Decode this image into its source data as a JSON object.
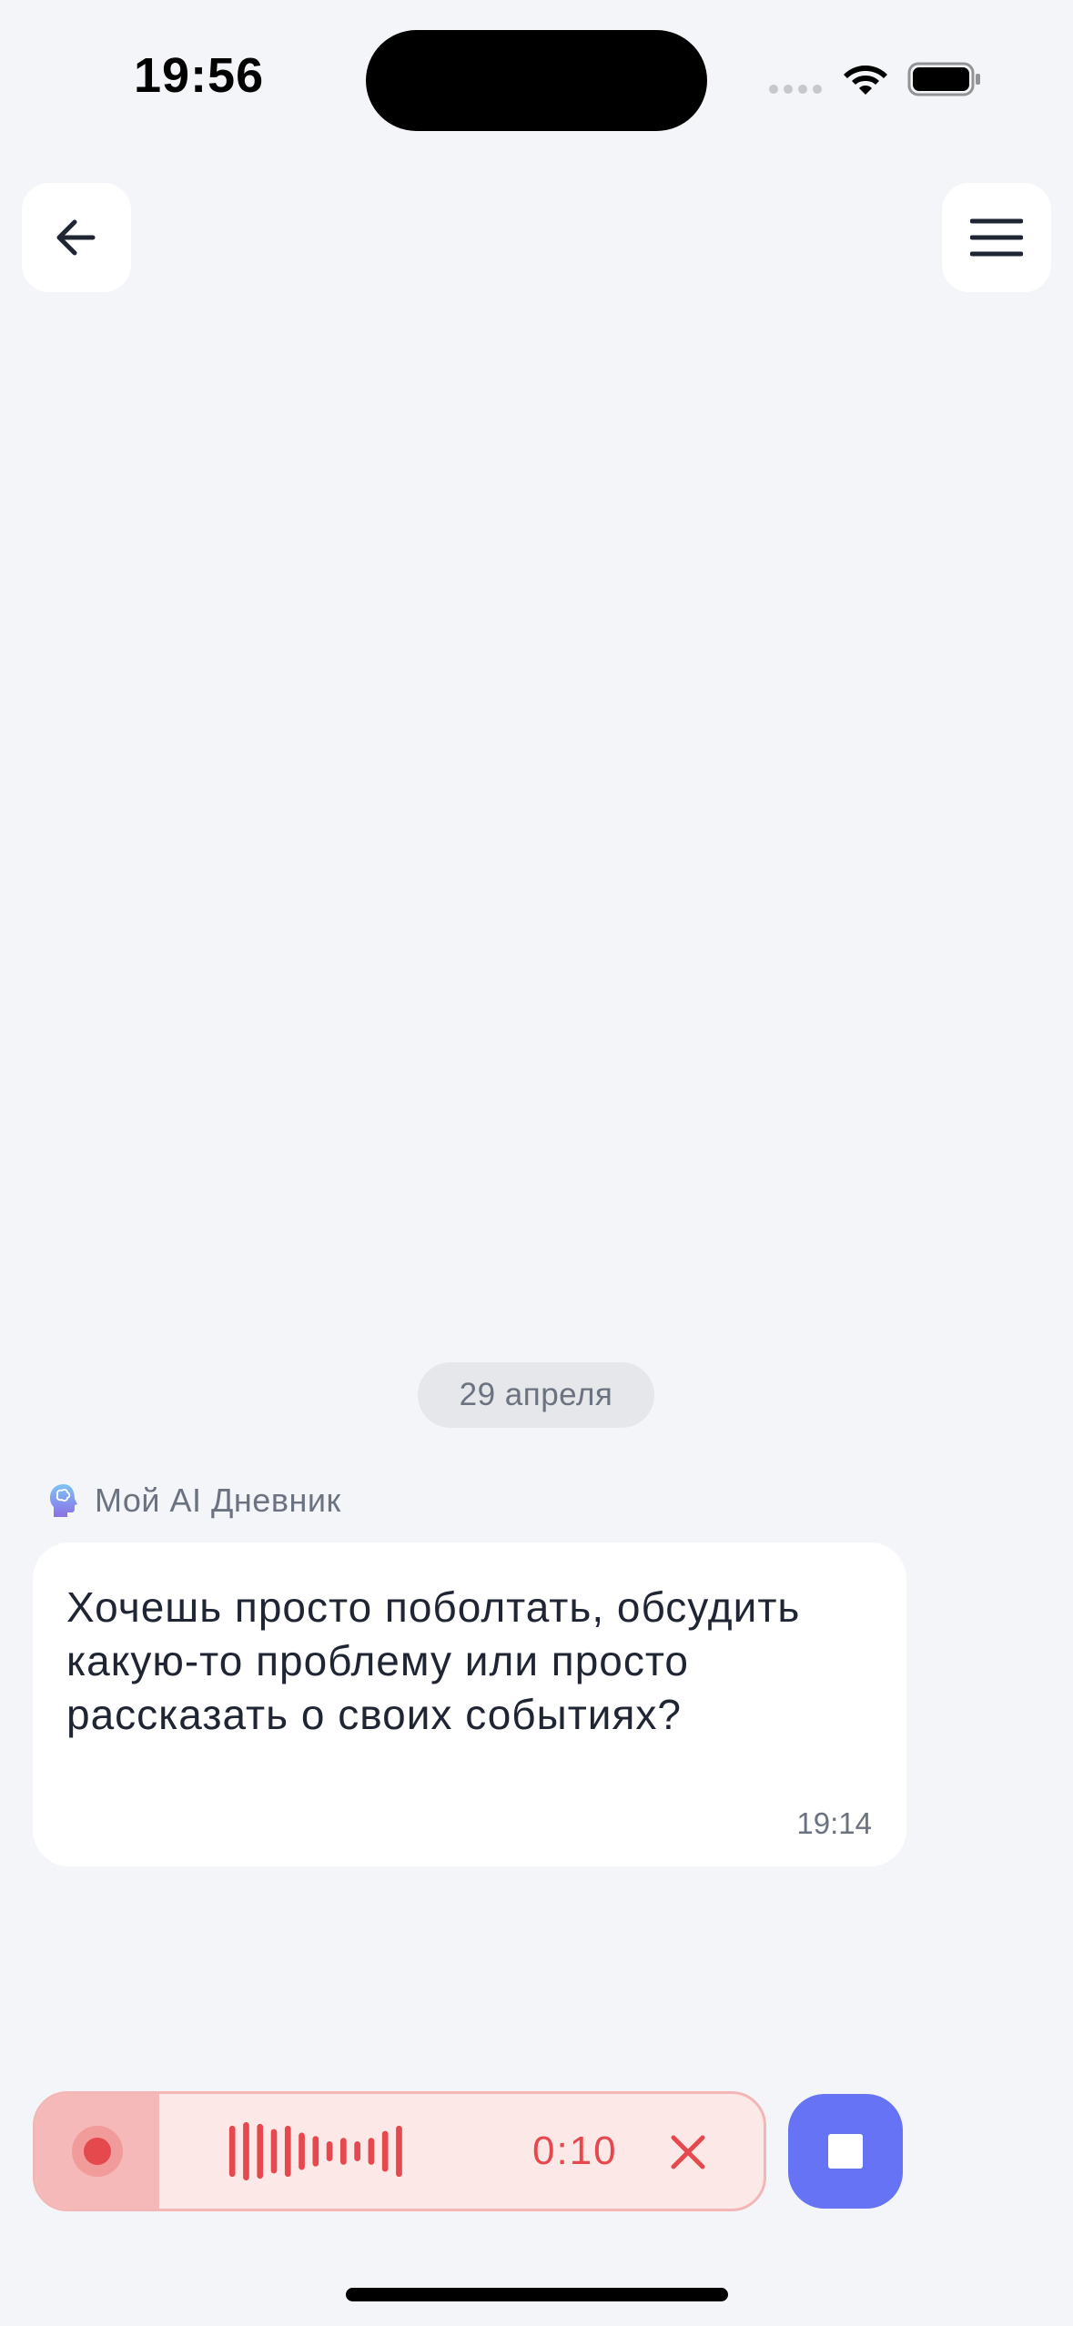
{
  "status_bar": {
    "time": "19:56"
  },
  "header": {
    "back_icon": "arrow-left-icon",
    "menu_icon": "hamburger-menu-icon"
  },
  "chat": {
    "date_separator": "29 апреля",
    "sender_name": "Мой AI Дневник",
    "sender_icon": "brain-avatar-icon",
    "messages": [
      {
        "text": "Хочешь просто поболтать, обсудить какую-то проблему или просто рассказать о своих событиях?",
        "time": "19:14"
      }
    ]
  },
  "recorder": {
    "duration": "0:10",
    "recording_icon": "recording-dot-icon",
    "cancel_icon": "close-icon",
    "stop_icon": "stop-icon"
  },
  "colors": {
    "background": "#f4f5f8",
    "recording_red": "#e5484d",
    "stop_button": "#6673f5"
  }
}
